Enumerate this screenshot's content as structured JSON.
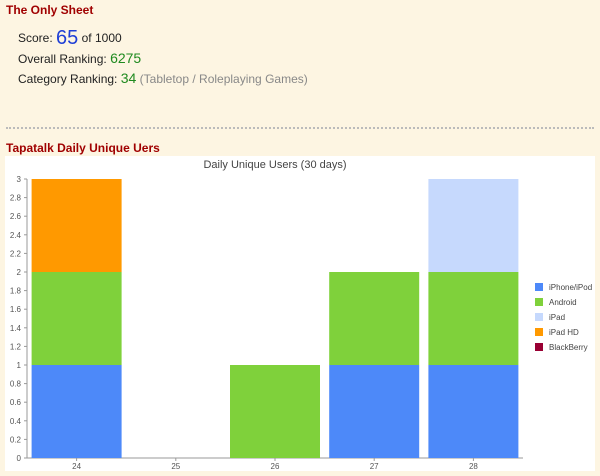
{
  "sheet": {
    "title": "The Only Sheet",
    "score_label": "Score:",
    "score_value": "65",
    "score_suffix": "of 1000",
    "overall_label": "Overall Ranking:",
    "overall_value": "6275",
    "category_label": "Category Ranking:",
    "category_value": "34",
    "category_note": "(Tabletop / Roleplaying Games)"
  },
  "tapatalk": {
    "title": "Tapatalk Daily Unique Uers"
  },
  "colors": {
    "title_red": "#a00000",
    "score_blue": "#1f3fd6",
    "rank_green": "#1f8a1f",
    "page_bg": "#fdf5e2"
  },
  "chart_data": {
    "type": "bar",
    "stacked": true,
    "title": "Daily Unique Users (30 days)",
    "categories": [
      "24",
      "25",
      "26",
      "27",
      "28"
    ],
    "ylim": [
      0,
      3
    ],
    "yticks": [
      "0",
      "0.2",
      "0.4",
      "0.6",
      "0.8",
      "1",
      "1.2",
      "1.4",
      "1.6",
      "1.8",
      "2",
      "2.2",
      "2.4",
      "2.6",
      "2.8",
      "3"
    ],
    "legend_position": "right",
    "series": [
      {
        "name": "iPhone/iPod",
        "color": "#4d89f9",
        "values": [
          1,
          0,
          0,
          1,
          1
        ]
      },
      {
        "name": "Android",
        "color": "#7fd13b",
        "values": [
          1,
          0,
          1,
          1,
          1
        ]
      },
      {
        "name": "iPad",
        "color": "#c6d9fd",
        "values": [
          0,
          0,
          0,
          0,
          1
        ]
      },
      {
        "name": "iPad HD",
        "color": "#ff9900",
        "values": [
          1,
          0,
          0,
          0,
          0
        ]
      },
      {
        "name": "BlackBerry",
        "color": "#990033",
        "values": [
          0,
          0,
          0,
          0,
          0
        ]
      }
    ]
  }
}
